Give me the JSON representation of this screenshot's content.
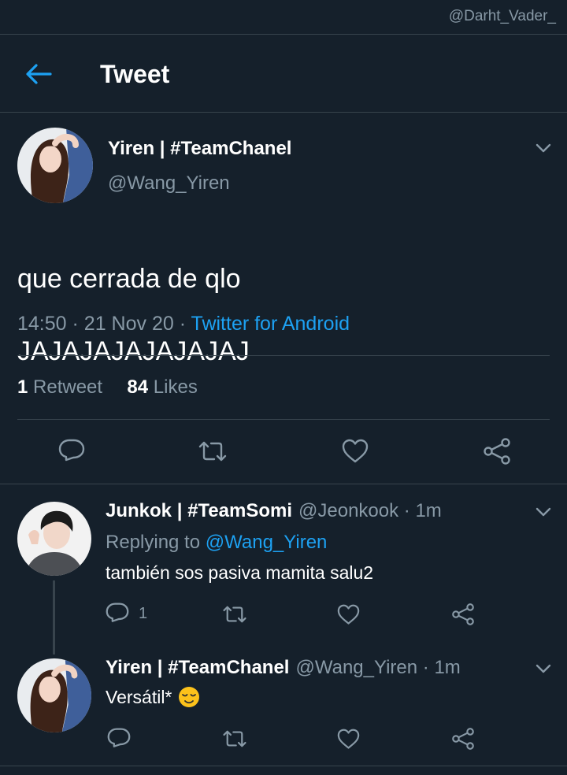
{
  "watermark": "@Darht_Vader_",
  "header": {
    "title": "Tweet"
  },
  "tweet": {
    "name": "Yiren | #TeamChanel",
    "handle": "@Wang_Yiren",
    "line1": "que cerrada de qlo",
    "line2": "JAJAJAJAJAJAJAJ",
    "time": "14:50",
    "date": "21 Nov 20",
    "source": "Twitter for Android",
    "retweet_count": "1",
    "retweet_label": "Retweet",
    "like_count": "84",
    "like_label": "Likes"
  },
  "replies": [
    {
      "name": "Junkok | #TeamSomi",
      "handle": "@Jeonkook",
      "age": "1m",
      "replying_prefix": "Replying to",
      "replying_to": "@Wang_Yiren",
      "text": "también sos pasiva mamita salu2",
      "reply_count": "1"
    },
    {
      "name": "Yiren | #TeamChanel",
      "handle": "@Wang_Yiren",
      "age": "1m",
      "text": "Versátil*",
      "emoji": "relieved-face-emoji"
    }
  ],
  "colors": {
    "background": "#15202b",
    "divider": "#38444d",
    "muted": "#8899a6",
    "accent": "#1da1f2"
  },
  "icons": [
    "back-arrow-icon",
    "chevron-down-icon",
    "reply-icon",
    "retweet-icon",
    "like-icon",
    "share-icon"
  ]
}
